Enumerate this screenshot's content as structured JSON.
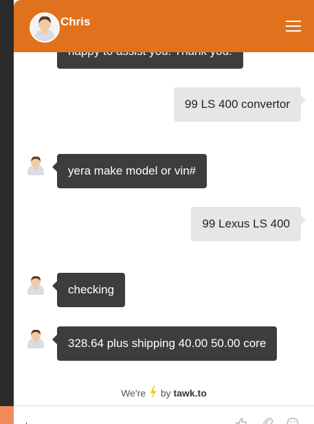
{
  "header": {
    "agent_name": "Chris"
  },
  "messages": [
    {
      "sender": "agent",
      "text": "happy to assist you. Thank you."
    },
    {
      "sender": "visitor",
      "text": "99 LS 400 convertor"
    },
    {
      "sender": "agent",
      "text": "yera make model or vin#"
    },
    {
      "sender": "visitor",
      "text": "99 Lexus LS 400"
    },
    {
      "sender": "agent",
      "text": "checking"
    },
    {
      "sender": "agent",
      "text": "328.64 plus shipping 40.00 50.00 core"
    }
  ],
  "footer": {
    "powered_prefix": "We're",
    "powered_by": "by",
    "brand": "tawk.to"
  },
  "colors": {
    "header": "#e1721d",
    "agent_bubble": "#3d3d3d",
    "visitor_bubble": "#e6e6e6",
    "bolt": "#f5c400"
  },
  "icons": [
    "menu-icon",
    "agent-avatar",
    "lightning-bolt-icon",
    "thumbs-up-icon",
    "paperclip-icon",
    "emoji-icon"
  ]
}
